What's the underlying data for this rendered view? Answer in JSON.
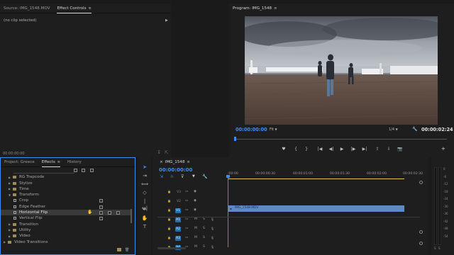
{
  "source_panel": {
    "tabs": [
      {
        "label": "Source: IMG_1548.MOV",
        "active": false
      },
      {
        "label": "Effect Controls",
        "active": true
      },
      {
        "label": "≡"
      }
    ],
    "no_clip_text": "(no clip selected)",
    "timecode": "00:00:00:00"
  },
  "program_monitor": {
    "title": "Program: IMG_1548",
    "menu": "≡",
    "timecode": "00:00:00:00",
    "fit": "Fit",
    "resolution": "1/4",
    "duration": "00:00:02:24"
  },
  "project_panel": {
    "tabs": [
      {
        "label": "Project: Greece",
        "active": false
      },
      {
        "label": "Effects",
        "active": true
      },
      {
        "label": "≡"
      },
      {
        "label": "History",
        "active": false
      }
    ],
    "items": [
      {
        "label": "RG Trapcode",
        "type": "folder",
        "indent": 1,
        "expanded": false
      },
      {
        "label": "Stylize",
        "type": "folder",
        "indent": 1,
        "expanded": false
      },
      {
        "label": "Time",
        "type": "folder",
        "indent": 1,
        "expanded": false
      },
      {
        "label": "Transform",
        "type": "folder",
        "indent": 1,
        "expanded": true
      },
      {
        "label": "Crop",
        "type": "effect",
        "indent": 2
      },
      {
        "label": "Edge Feather",
        "type": "effect",
        "indent": 2
      },
      {
        "label": "Horizontal Flip",
        "type": "effect",
        "indent": 2,
        "selected": true
      },
      {
        "label": "Vertical Flip",
        "type": "effect",
        "indent": 2
      },
      {
        "label": "Transition",
        "type": "folder",
        "indent": 1,
        "expanded": false
      },
      {
        "label": "Utility",
        "type": "folder",
        "indent": 1,
        "expanded": false
      },
      {
        "label": "Video",
        "type": "folder",
        "indent": 1,
        "expanded": false
      },
      {
        "label": "Video Transitions",
        "type": "folder",
        "indent": 0,
        "expanded": false
      }
    ]
  },
  "timeline": {
    "tab": "IMG_1548",
    "menu": "≡",
    "timecode": "00:00:00:00",
    "ruler": [
      ":00:00",
      "00:00:00:30",
      "00:00:01:00",
      "00:00:01:30",
      "00:00:02:00",
      "00:00:02:30"
    ],
    "tracks": [
      {
        "label": "V3",
        "kind": "video"
      },
      {
        "label": "V2",
        "kind": "video"
      },
      {
        "label": "V1",
        "kind": "video",
        "target": "V1"
      },
      {
        "label": "A1",
        "kind": "audio",
        "target": "A1"
      },
      {
        "label": "A2",
        "kind": "audio",
        "target": "A2"
      },
      {
        "label": "A3",
        "kind": "audio",
        "target": "A3"
      },
      {
        "label": "A4",
        "kind": "audio",
        "target": "A4"
      }
    ],
    "track_glyphs": {
      "sync_lock": "🔒",
      "eye": "👁",
      "mute": "M",
      "solo": "S",
      "mic": "🎙"
    },
    "clip": {
      "name": "IMG_1548.MOV",
      "color": "#5a8bc4"
    }
  },
  "audio_meter": {
    "labels": [
      "0",
      "-6",
      "-12",
      "-18",
      "-24",
      "-30",
      "-36",
      "-42",
      "-48",
      "-54"
    ],
    "bottom": [
      "S",
      "S"
    ]
  },
  "tools": [
    {
      "name": "selection-tool-icon",
      "glyph": "➤"
    },
    {
      "name": "track-select-tool-icon",
      "glyph": "⇥"
    },
    {
      "name": "ripple-edit-tool-icon",
      "glyph": "⟺"
    },
    {
      "name": "razor-tool-icon",
      "glyph": "◇"
    },
    {
      "name": "slip-tool-icon",
      "glyph": "|↔|"
    },
    {
      "name": "pen-tool-icon",
      "glyph": "✒"
    },
    {
      "name": "hand-tool-icon",
      "glyph": "✋"
    },
    {
      "name": "type-tool-icon",
      "glyph": "T"
    }
  ],
  "program_controls": [
    {
      "name": "add-marker-icon",
      "glyph": "♥"
    },
    {
      "name": "mark-in-icon",
      "glyph": "{"
    },
    {
      "name": "mark-out-icon",
      "glyph": "}"
    },
    {
      "name": "go-to-in-icon",
      "glyph": "|◀"
    },
    {
      "name": "step-back-icon",
      "glyph": "◀|"
    },
    {
      "name": "play-icon",
      "glyph": "▶"
    },
    {
      "name": "step-forward-icon",
      "glyph": "|▶"
    },
    {
      "name": "go-to-out-icon",
      "glyph": "▶|"
    },
    {
      "name": "lift-icon",
      "glyph": "⇪"
    },
    {
      "name": "extract-icon",
      "glyph": "⇩"
    },
    {
      "name": "export-frame-icon",
      "glyph": "📷"
    }
  ],
  "colors": {
    "accent_blue": "#3b8cff",
    "clip_blue": "#5a8bc4",
    "track_blue": "#1f6fb0"
  }
}
